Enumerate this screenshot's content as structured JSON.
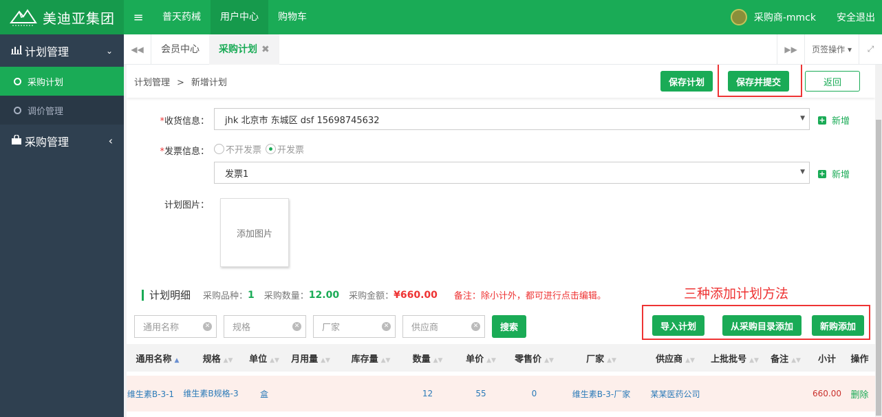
{
  "app": {
    "logo_text": "美迪亚集团",
    "nav": [
      "普天药械",
      "用户中心",
      "购物车"
    ],
    "active_nav": 1,
    "user": "采购商-mmck",
    "logout": "安全退出"
  },
  "sidebar": {
    "groups": [
      {
        "label": "计划管理",
        "caret": "⌄",
        "items": [
          {
            "label": "采购计划",
            "active": true
          },
          {
            "label": "调价管理",
            "active": false
          }
        ]
      },
      {
        "label": "采购管理",
        "caret": "‹"
      }
    ]
  },
  "tabs": {
    "items": [
      {
        "label": "会员中心"
      },
      {
        "label": "采购计划",
        "closable": "✖"
      }
    ],
    "page_ops": "页签操作"
  },
  "header": {
    "breadcrumb": [
      "计划管理",
      "新增计划"
    ],
    "breadcrumb_sep": ">",
    "save_plan": "保存计划",
    "save_submit": "保存并提交",
    "back": "返回"
  },
  "form": {
    "receive_label": "收货信息：",
    "receive_value": "jhk  北京市  东城区  dsf  15698745632",
    "invoice_label": "发票信息：",
    "invoice_options": [
      "不开发票",
      "开发票"
    ],
    "invoice_selected": 1,
    "invoice_value": "发票1",
    "add_label": "新增",
    "image_label": "计划图片：",
    "add_image": "添加图片",
    "required_mark": "*"
  },
  "detail": {
    "title": "计划明细",
    "kinds_label": "采购品种：",
    "kinds_value": "1",
    "qty_label": "采购数量：",
    "qty_value": "12.00",
    "amount_label": "采购金额：",
    "amount_value": "¥660.00",
    "note": "备注：除小计外，都可进行点击编辑。",
    "annotation": "三种添加计划方法"
  },
  "search": {
    "placeholders": [
      "通用名称",
      "规格",
      "厂家",
      "供应商"
    ],
    "search_btn": "搜索",
    "import_btn": "导入计划",
    "catalog_btn": "从采购目录添加",
    "new_btn": "新购添加"
  },
  "table": {
    "columns": [
      "通用名称",
      "规格",
      "单位",
      "月用量",
      "库存量",
      "数量",
      "单价",
      "零售价",
      "厂家",
      "供应商",
      "上批批号",
      "备注",
      "小计",
      "操作"
    ],
    "rows": [
      {
        "name": "维生素B-3-1",
        "spec": "维生素B规格-3",
        "unit": "盒",
        "monthly": "",
        "stock": "",
        "qty": "12",
        "price": "55",
        "retail": "0",
        "maker": "维生素B-3-厂家",
        "supplier": "某某医药公司",
        "batch": "",
        "remark": "",
        "subtotal": "660.00",
        "action": "删除"
      }
    ]
  }
}
